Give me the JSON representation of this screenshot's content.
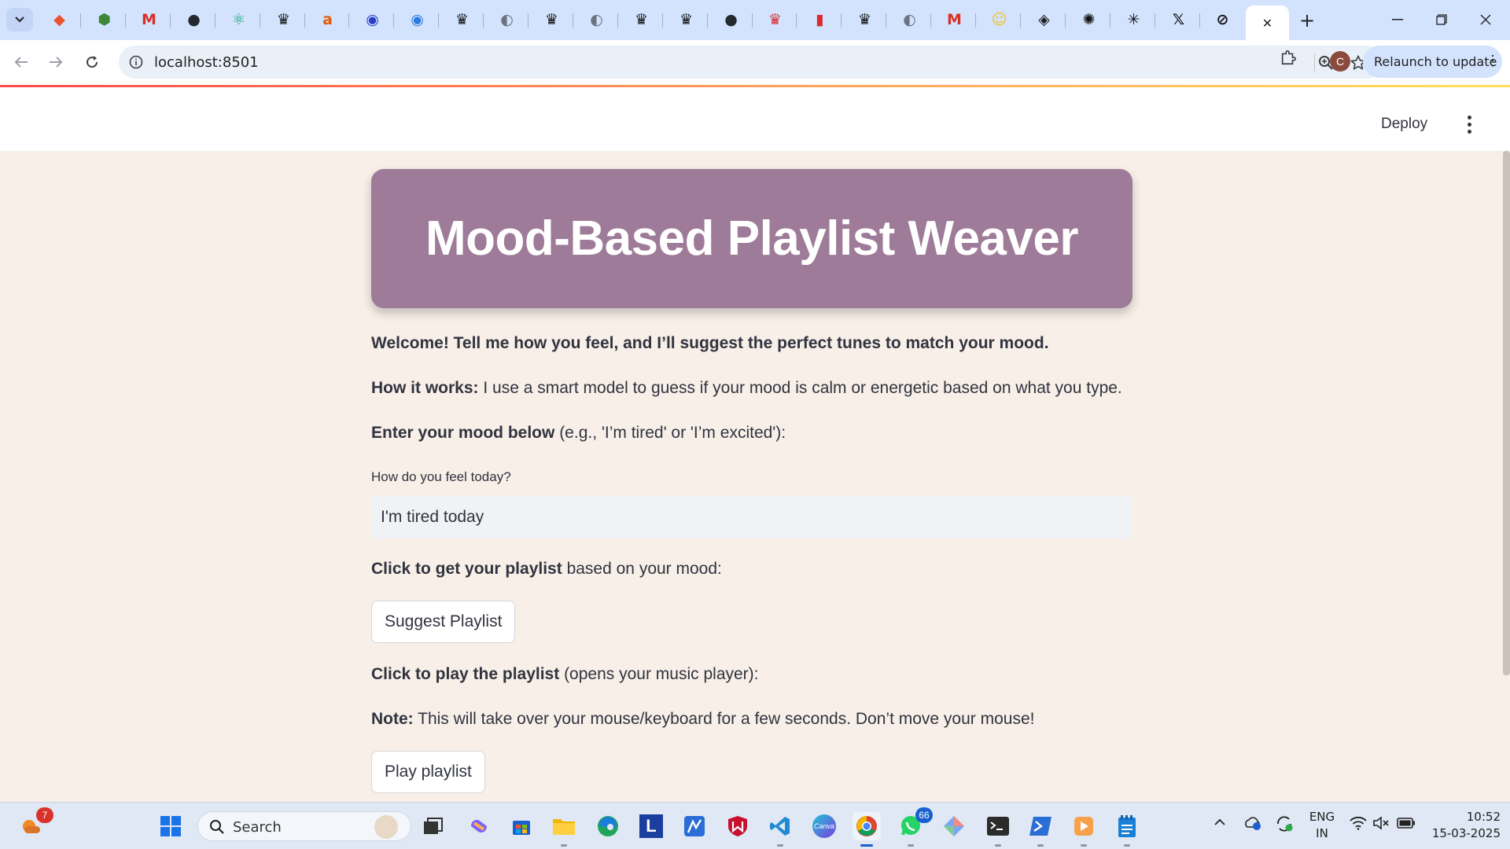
{
  "browser": {
    "url": "localhost:8501",
    "relaunch_label": "Relaunch to update",
    "profile_initial": "C",
    "tabs": [
      {
        "icon": "git-icon",
        "color": "#e8542f"
      },
      {
        "icon": "node-icon",
        "color": "#3c873a"
      },
      {
        "icon": "gmail-icon",
        "color": "#d93025"
      },
      {
        "icon": "github-icon",
        "color": "#24292f"
      },
      {
        "icon": "react-icon",
        "color": "#1aa37a"
      },
      {
        "icon": "kaggle-crown-icon",
        "color": "#111111"
      },
      {
        "icon": "ai-icon",
        "color": "#e65a00"
      },
      {
        "icon": "circle-logo-icon",
        "color": "#2a3ec8"
      },
      {
        "icon": "circle-logo-icon",
        "color": "#2c7be0"
      },
      {
        "icon": "kaggle-crown-icon",
        "color": "#111111"
      },
      {
        "icon": "globe-icon",
        "color": "#6b7280"
      },
      {
        "icon": "kaggle-crown-icon",
        "color": "#111111"
      },
      {
        "icon": "globe-icon",
        "color": "#6b7280"
      },
      {
        "icon": "kaggle-crown-icon",
        "color": "#111111"
      },
      {
        "icon": "kaggle-crown-icon",
        "color": "#111111"
      },
      {
        "icon": "github-icon",
        "color": "#24292f"
      },
      {
        "icon": "crown-red-icon",
        "color": "#d92b2b"
      },
      {
        "icon": "bookmark-red-icon",
        "color": "#d92b2b"
      },
      {
        "icon": "kaggle-crown-icon",
        "color": "#111111"
      },
      {
        "icon": "globe-icon",
        "color": "#6b7280"
      },
      {
        "icon": "gmail-icon",
        "color": "#d93025"
      },
      {
        "icon": "emoji-icon",
        "color": "#f2c21b"
      },
      {
        "icon": "app-error-icon",
        "color": "#222222"
      },
      {
        "icon": "openai-icon",
        "color": "#111111"
      },
      {
        "icon": "perplexity-icon",
        "color": "#111111"
      },
      {
        "icon": "x-icon",
        "color": "#111111"
      },
      {
        "icon": "no-entry-icon",
        "color": "#111111"
      },
      {
        "icon": "close-icon",
        "color": "#111111"
      }
    ]
  },
  "app": {
    "deploy_label": "Deploy",
    "title": "Mood-Based Playlist Weaver",
    "welcome": "Welcome! Tell me how you feel, and I’ll suggest the perfect tunes to match your mood.",
    "how_bold": "How it works:",
    "how_text": " I use a smart model to guess if your mood is calm or energetic based on what you type.",
    "enter_bold": "Enter your mood below",
    "enter_text": " (e.g., 'I’m tired' or 'I’m excited'):",
    "field_label": "How do you feel today?",
    "mood_value": "I'm tired today",
    "click_get_bold": "Click to get your playlist",
    "click_get_text": " based on your mood:",
    "suggest_label": "Suggest Playlist",
    "click_play_bold": "Click to play the playlist",
    "click_play_text": " (opens your music player):",
    "note_bold": "Note:",
    "note_text": " This will take over your mouse/keyboard for a few seconds. Don’t move your mouse!",
    "play_label": "Play playlist",
    "colors": {
      "title_bg": "#9e7b98",
      "page_bg": "#f7efe8",
      "text": "#31333f"
    }
  },
  "taskbar": {
    "search_label": "Search",
    "weather_badge": "7",
    "whatsapp_badge": "66",
    "lang_top": "ENG",
    "lang_bottom": "IN",
    "time": "10:52",
    "date": "15-03-2025"
  }
}
